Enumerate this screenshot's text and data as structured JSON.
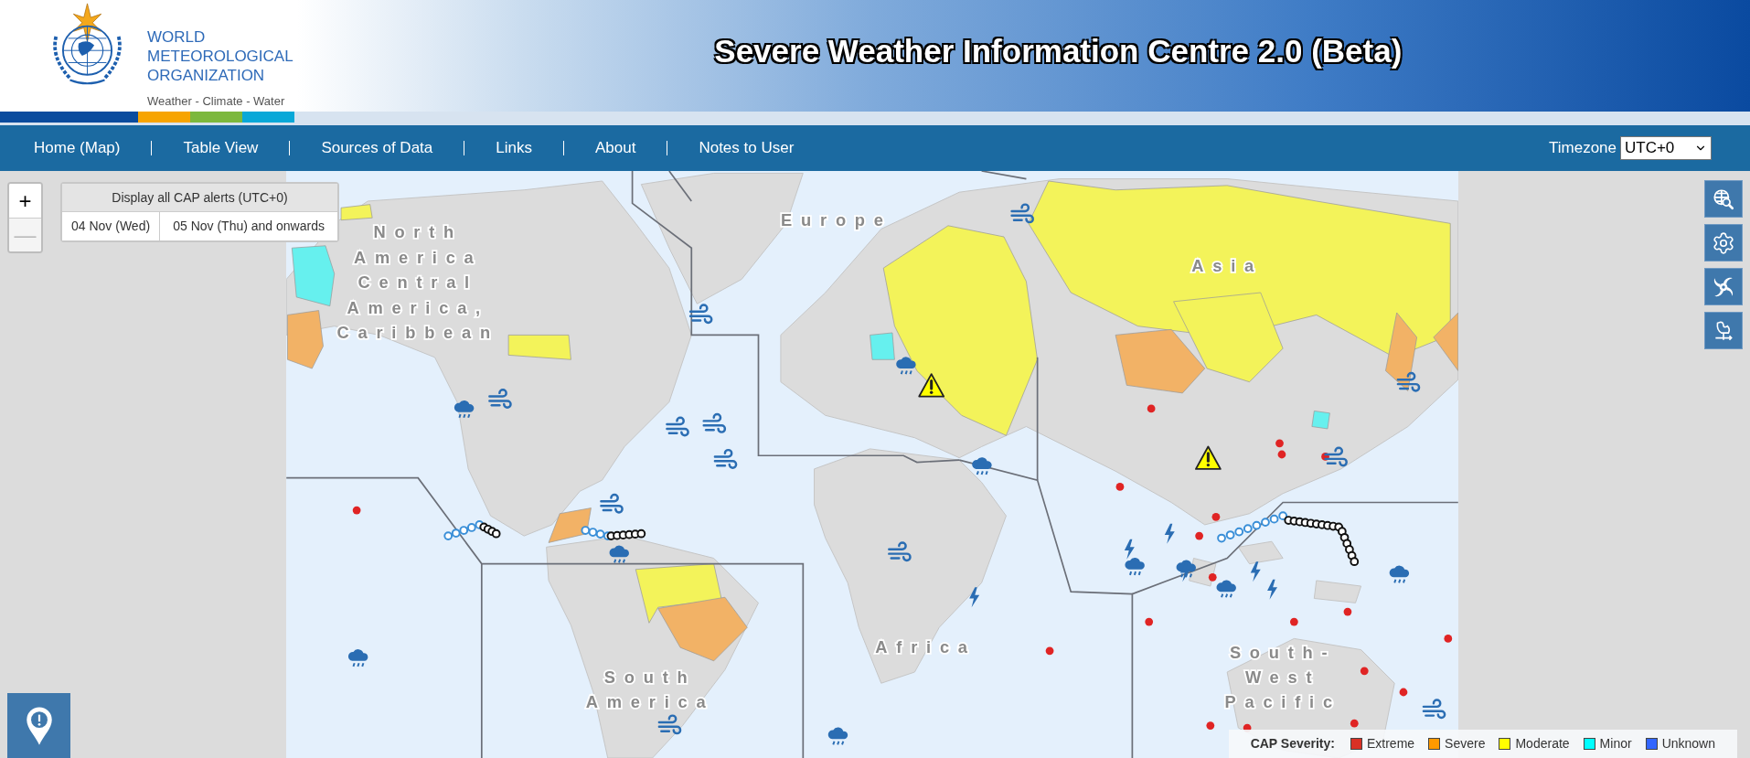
{
  "header": {
    "logo_lines": [
      "WORLD",
      "METEOROLOGICAL",
      "ORGANIZATION"
    ],
    "tagline": "Weather - Climate - Water",
    "title": "Severe Weather Information Centre 2.0 (Beta)"
  },
  "nav": {
    "items": [
      "Home (Map)",
      "Table View",
      "Sources of Data",
      "Links",
      "About",
      "Notes to User"
    ],
    "timezone": {
      "label": "Timezone",
      "value": "UTC+0"
    }
  },
  "map": {
    "zoom": [
      {
        "symbol": "+",
        "disabled": false
      },
      {
        "symbol": "—",
        "disabled": true
      }
    ],
    "cap_panel": {
      "title": "Display all CAP alerts (UTC+0)",
      "days": [
        "04 Nov (Wed)",
        "05 Nov (Thu) and onwards"
      ]
    },
    "region_labels": [
      {
        "lines": [
          "North",
          "America",
          "Central",
          "America,",
          "Caribbean"
        ]
      },
      {
        "lines": [
          "Europe"
        ]
      },
      {
        "lines": [
          "Asia"
        ]
      },
      {
        "lines": [
          "Africa"
        ]
      },
      {
        "lines": [
          "South",
          "America"
        ]
      },
      {
        "lines": [
          "South-",
          "West",
          "Pacific"
        ]
      }
    ],
    "legend": {
      "title": "CAP Severity:",
      "items": [
        {
          "label": "Extreme",
          "color": "#d93025"
        },
        {
          "label": "Severe",
          "color": "#ff9900"
        },
        {
          "label": "Moderate",
          "color": "#ffff00"
        },
        {
          "label": "Minor",
          "color": "#00ffff"
        },
        {
          "label": "Unknown",
          "color": "#3366ff"
        }
      ]
    }
  }
}
